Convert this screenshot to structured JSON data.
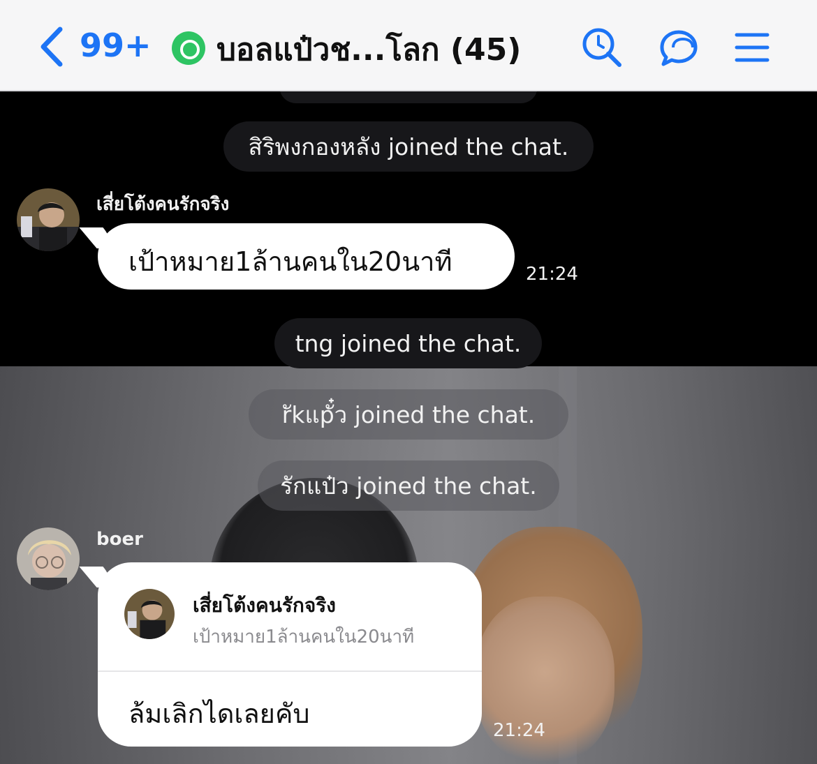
{
  "header": {
    "unread_count": "99+",
    "group_name": "บอลแป๋วช...โลก (45)"
  },
  "messages": {
    "sys1": "สิริพงกองหลัง joined the chat.",
    "msg1": {
      "sender": "เสี่ยโต้งคนรักจริง",
      "text": "เป้าหมาย1ล้านคนใน20นาที",
      "time": "21:24"
    },
    "sys2": "tng joined the chat.",
    "sys3": "rัkแpั๋ว joined the chat.",
    "sys4": "รักแป๋ว joined the chat.",
    "msg2": {
      "sender": "boer",
      "reply_to_sender": "เสี่ยโต้งคนรักจริง",
      "reply_to_text": "เป้าหมาย1ล้านคนใน20นาที",
      "text": "ล้มเลิกไดเลยคับ",
      "time": "21:24"
    }
  },
  "colors": {
    "accent": "#1d74f5",
    "group_badge": "#2ec463",
    "header_bg": "#f6f6f7"
  },
  "icons": [
    "back-chevron-icon",
    "group-icon",
    "search-icon",
    "chat-bubbles-icon",
    "menu-icon"
  ]
}
